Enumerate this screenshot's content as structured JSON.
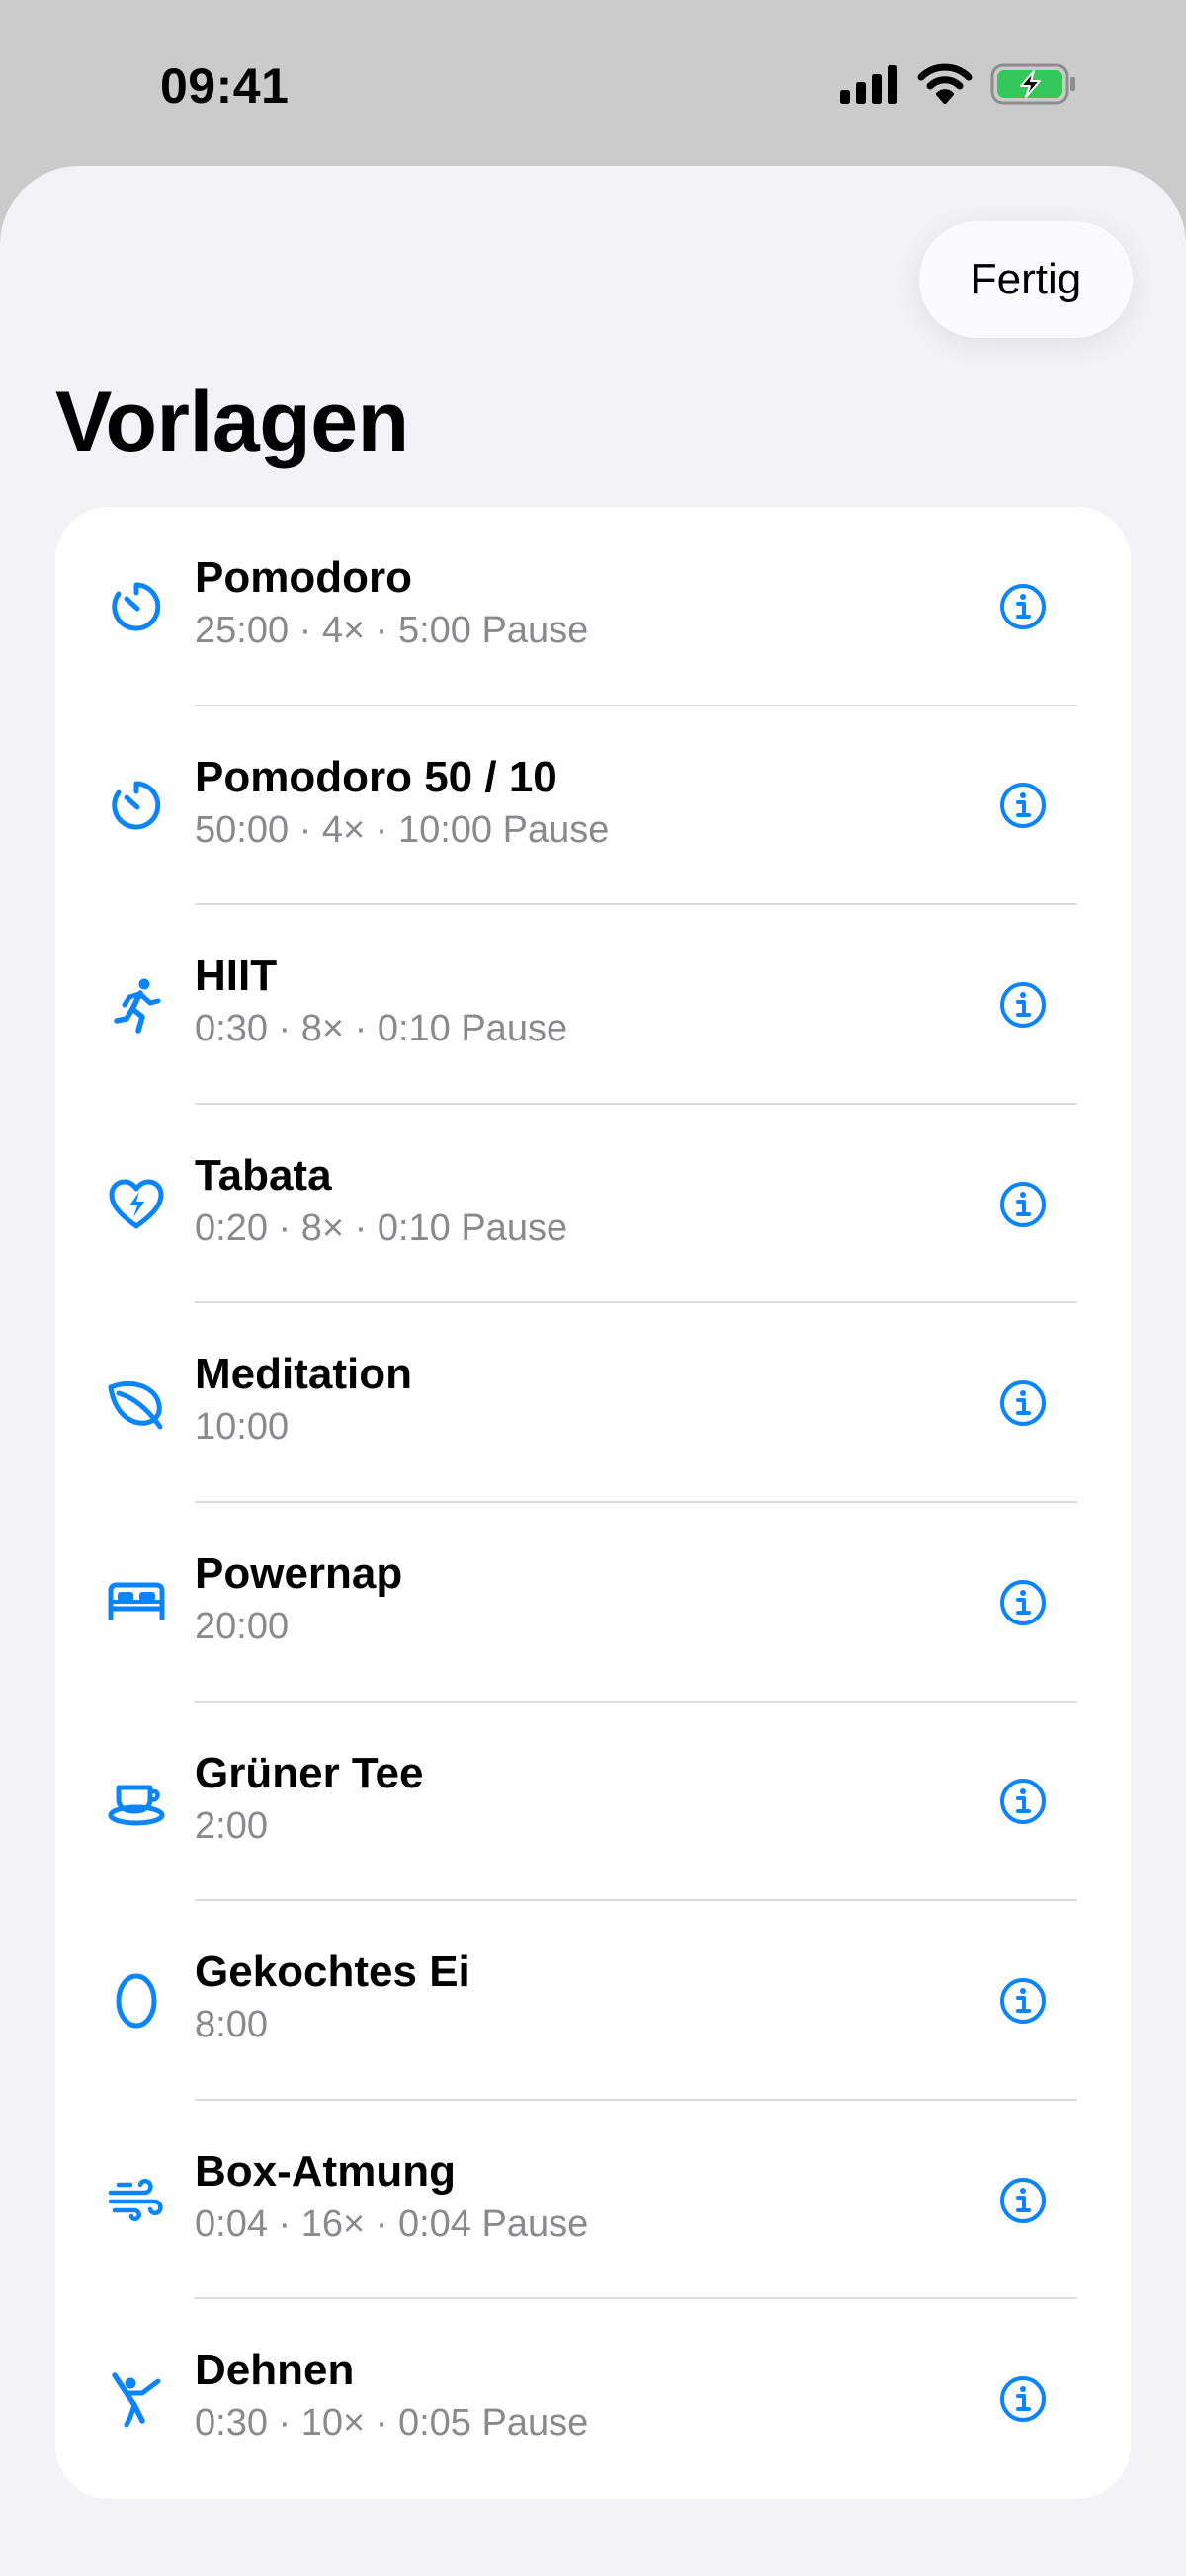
{
  "status_bar": {
    "time": "09:41"
  },
  "header": {
    "done_label": "Fertig",
    "title": "Vorlagen"
  },
  "colors": {
    "accent": "#0a84ff",
    "battery": "#34c759"
  },
  "templates": [
    {
      "title": "Pomodoro",
      "subtitle": "25:00 · 4× · 5:00 Pause",
      "icon": "timer-icon"
    },
    {
      "title": "Pomodoro 50 / 10",
      "subtitle": "50:00 · 4× · 10:00 Pause",
      "icon": "timer-icon"
    },
    {
      "title": "HIIT",
      "subtitle": "0:30 · 8× · 0:10 Pause",
      "icon": "running-figure-icon"
    },
    {
      "title": "Tabata",
      "subtitle": "0:20 · 8× · 0:10 Pause",
      "icon": "heart-bolt-icon"
    },
    {
      "title": "Meditation",
      "subtitle": "10:00",
      "icon": "leaf-icon"
    },
    {
      "title": "Powernap",
      "subtitle": "20:00",
      "icon": "bed-icon"
    },
    {
      "title": "Grüner Tee",
      "subtitle": "2:00",
      "icon": "cup-icon"
    },
    {
      "title": "Gekochtes Ei",
      "subtitle": "8:00",
      "icon": "oval-icon"
    },
    {
      "title": "Box-Atmung",
      "subtitle": "0:04 · 16× · 0:04 Pause",
      "icon": "wind-icon"
    },
    {
      "title": "Dehnen",
      "subtitle": "0:30 · 10× · 0:05 Pause",
      "icon": "stretching-figure-icon"
    }
  ]
}
